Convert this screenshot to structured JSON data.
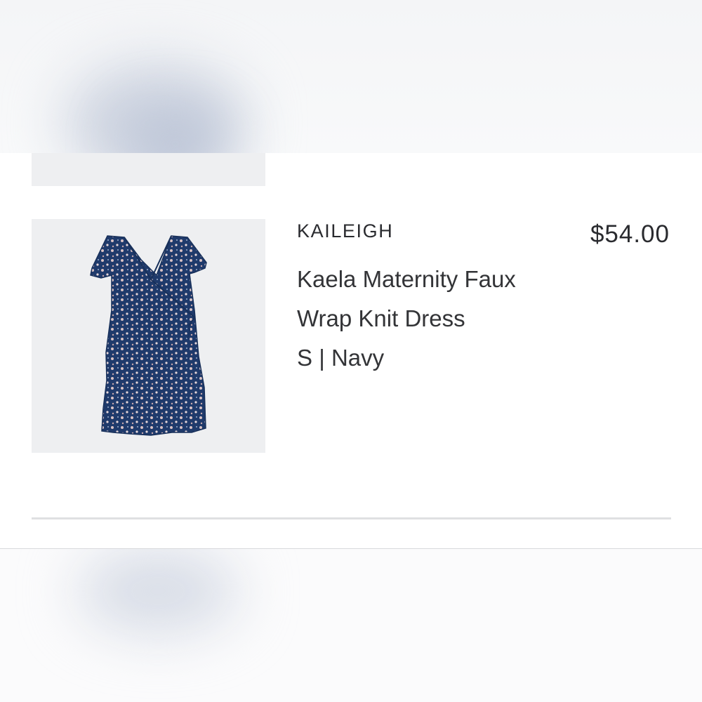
{
  "item": {
    "brand": "KAILEIGH",
    "price": "$54.00",
    "name": "Kaela Maternity Faux Wrap Knit Dress",
    "size": "S",
    "separator": "|",
    "color": "Navy"
  },
  "icons": {
    "product_image": "dress-icon"
  },
  "colors": {
    "card_background": "#ffffff",
    "image_background": "#eeeff1",
    "dress_navy": "#1f3a6b",
    "text": "#2a2b2f"
  }
}
